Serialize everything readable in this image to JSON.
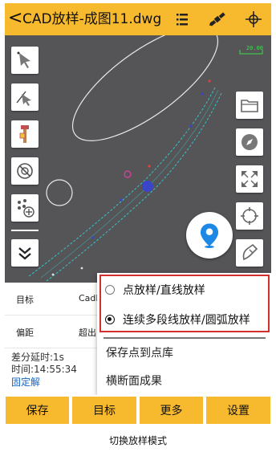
{
  "header": {
    "back_symbol": "<",
    "title": "CAD放样-成图11.dwg",
    "icons": [
      "list-icon",
      "satellite-icon",
      "crosshair-icon"
    ]
  },
  "map": {
    "scale_label": "20.00",
    "left_tools": [
      "select-arrow-icon",
      "line-select-icon",
      "survey-pole-icon",
      "no-target-icon",
      "add-points-icon",
      "collapse-down-icon"
    ],
    "right_tools": [
      "folder-icon",
      "compass-icon",
      "fit-extent-icon",
      "target-icon",
      "edit-pen-icon"
    ],
    "location_button_icon": "location-pin-icon"
  },
  "info": {
    "rows": [
      {
        "label": "目标",
        "value": "CadR"
      },
      {
        "label": "偏距",
        "value": "超出"
      }
    ],
    "status_lines": [
      "差分延时:1s",
      "时间:14:55:34"
    ],
    "solution": "固定解"
  },
  "dropdown": {
    "options": [
      {
        "label": "点放样/直线放样",
        "selected": false
      },
      {
        "label": "连续多段线放样/圆弧放样",
        "selected": true
      }
    ],
    "items": [
      "保存点到点库",
      "横断面成果"
    ]
  },
  "bottom_buttons": [
    "保存",
    "目标",
    "更多",
    "设置"
  ],
  "caption": "切换放样模式",
  "colors": {
    "accent": "#f7ba2e",
    "map_bg": "#555558",
    "highlight_border": "#d32f2f",
    "solution_text": "#1565c0",
    "cad_lines": "#34c3c8"
  }
}
